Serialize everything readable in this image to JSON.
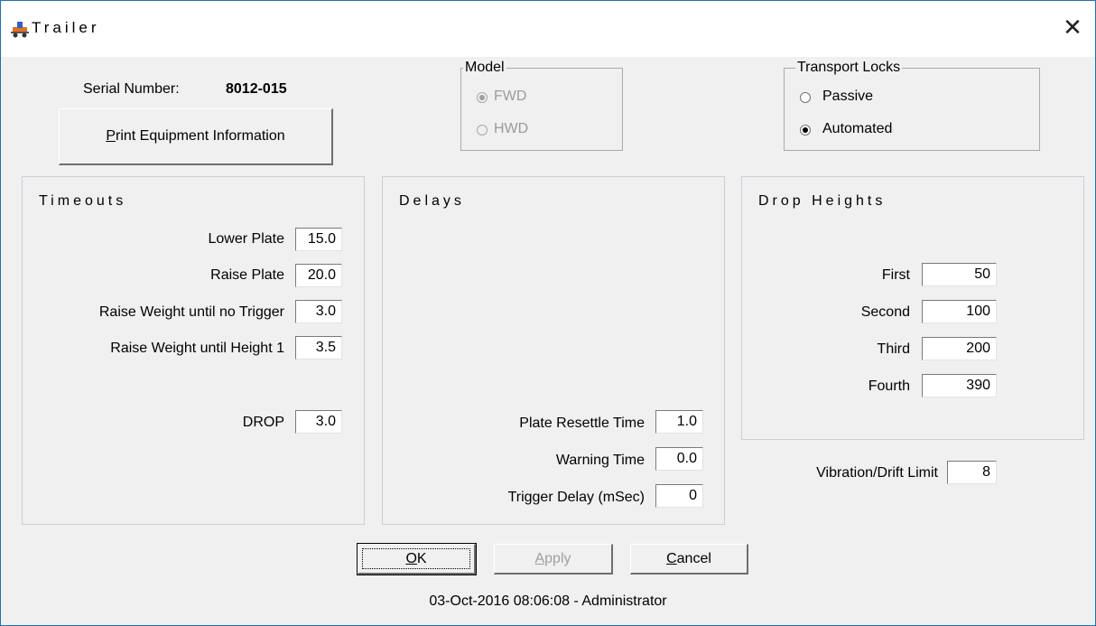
{
  "window": {
    "title": "Trailer"
  },
  "equipment": {
    "serial_label": "Serial Number:",
    "serial_value": "8012-015",
    "print_pre": "",
    "print_acc": "P",
    "print_post": "rint Equipment Information"
  },
  "model": {
    "legend": "Model",
    "options": [
      {
        "label": "FWD",
        "selected": true,
        "enabled": false
      },
      {
        "label": "HWD",
        "selected": false,
        "enabled": false
      }
    ]
  },
  "transport_locks": {
    "legend": "Transport Locks",
    "options": [
      {
        "label": "Passive",
        "selected": false
      },
      {
        "label": "Automated",
        "selected": true
      }
    ]
  },
  "timeouts": {
    "title": "Timeouts",
    "fields": [
      {
        "label": "Lower Plate",
        "value": "15.0"
      },
      {
        "label": "Raise Plate",
        "value": "20.0"
      },
      {
        "label": "Raise Weight until no Trigger",
        "value": "3.0"
      },
      {
        "label": "Raise Weight until Height 1",
        "value": "3.5"
      },
      {
        "label": "DROP",
        "value": "3.0"
      }
    ]
  },
  "delays": {
    "title": "Delays",
    "fields": [
      {
        "label": "Plate Resettle Time",
        "value": "1.0"
      },
      {
        "label": "Warning Time",
        "value": "0.0"
      },
      {
        "label": "Trigger Delay (mSec)",
        "value": "0"
      }
    ]
  },
  "drop_heights": {
    "title": "Drop Heights",
    "fields": [
      {
        "label": "First",
        "value": "50"
      },
      {
        "label": "Second",
        "value": "100"
      },
      {
        "label": "Third",
        "value": "200"
      },
      {
        "label": "Fourth",
        "value": "390"
      }
    ]
  },
  "vibration": {
    "label": "Vibration/Drift Limit",
    "value": "8"
  },
  "buttons": {
    "ok_acc": "O",
    "ok_post": "K",
    "apply_acc": "A",
    "apply_post": "pply",
    "cancel_acc": "C",
    "cancel_post": "ancel"
  },
  "status": "03-Oct-2016 08:06:08 - Administrator",
  "colors": {
    "window_border": "#1e6fbf",
    "face": "#f0f0f0",
    "disabled_text": "#a0a0a0"
  }
}
